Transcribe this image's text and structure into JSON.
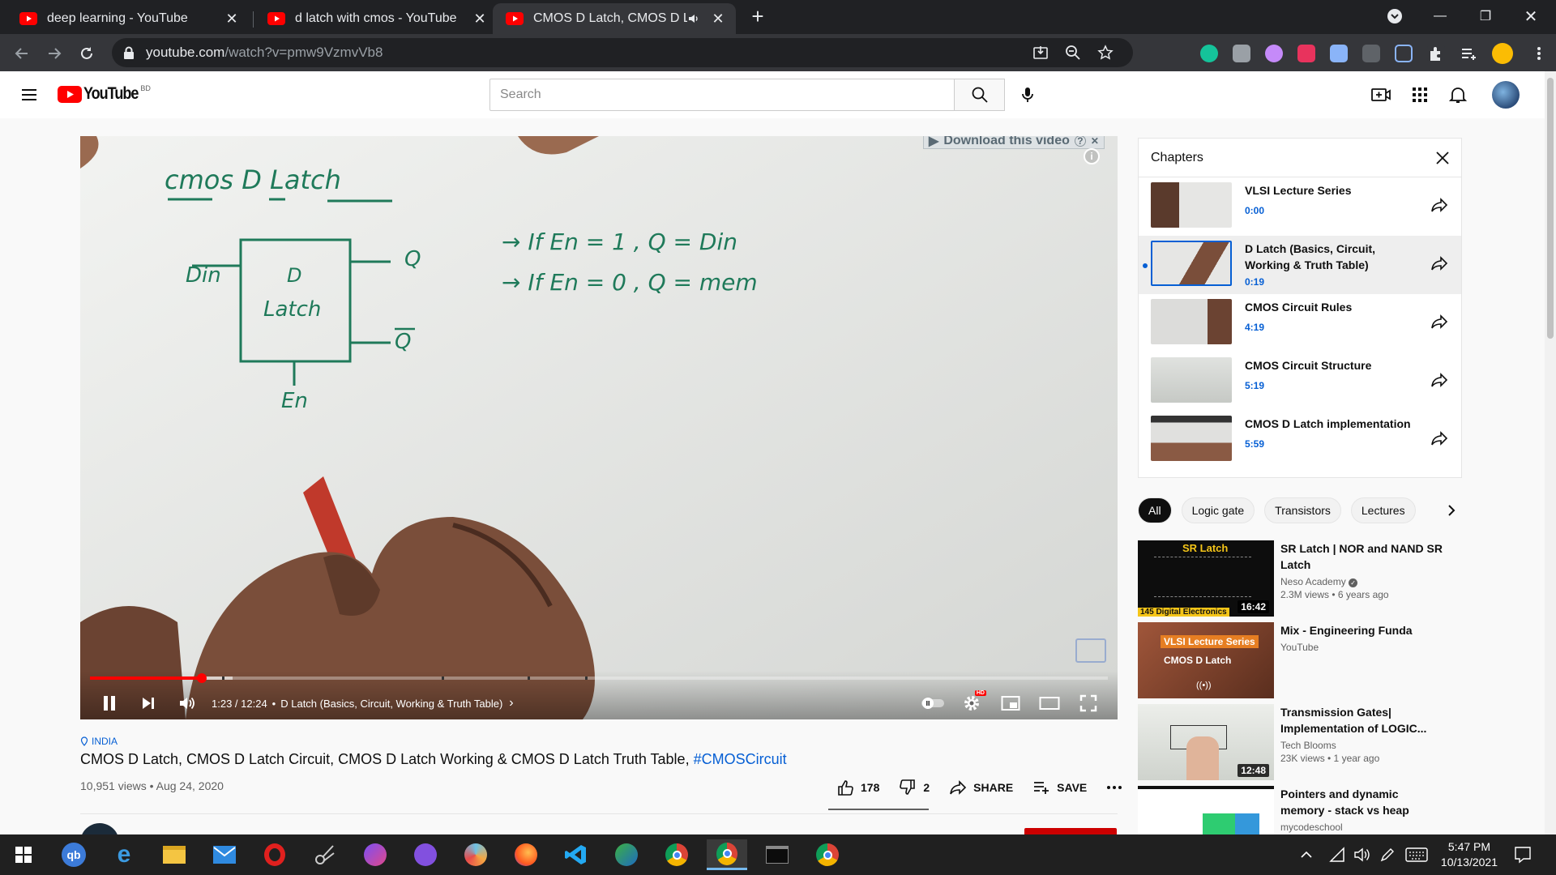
{
  "browser": {
    "tabs": [
      {
        "title": "deep learning - YouTube"
      },
      {
        "title": "d latch with cmos - YouTube"
      },
      {
        "title": "CMOS D Latch, CMOS D Latc"
      }
    ],
    "url_prefix": "youtube.com",
    "url_path": "/watch?v=pmw9VzmvVb8"
  },
  "masthead": {
    "logo_text": "YouTube",
    "country_code": "BD",
    "search_placeholder": "Search"
  },
  "player": {
    "overlay_download": "Download this video",
    "time": "1:23 / 12:24",
    "chapter_label": "D Latch (Basics, Circuit, Working & Truth Table)",
    "progress_fraction": 0.11,
    "buffered_fraction": 0.14,
    "board_title": "cmos D Latch",
    "board_input": "Din",
    "board_block_line1": "D",
    "board_block_line2": "Latch",
    "board_out_q": "Q",
    "board_out_qbar": "Q",
    "board_enable": "En",
    "board_rule1": "→ If En = 1 ,  Q = Din",
    "board_rule2": "→ If En = 0 ,  Q = mem"
  },
  "video": {
    "location": "INDIA",
    "title": "CMOS D Latch, CMOS D Latch Circuit, CMOS D Latch Working & CMOS D Latch Truth Table,",
    "hashtag": "#CMOSCircuit",
    "meta": "10,951 views • Aug 24, 2020",
    "likes": "178",
    "dislikes": "2",
    "share_label": "SHARE",
    "save_label": "SAVE"
  },
  "chapters": {
    "heading": "Chapters",
    "items": [
      {
        "title": "VLSI Lecture Series",
        "time": "0:00"
      },
      {
        "title": "D Latch (Basics, Circuit, Working & Truth Table)",
        "time": "0:19"
      },
      {
        "title": "CMOS Circuit Rules",
        "time": "4:19"
      },
      {
        "title": "CMOS Circuit Structure",
        "time": "5:19"
      },
      {
        "title": "CMOS D Latch implementation",
        "time": "5:59"
      }
    ]
  },
  "chips": [
    "All",
    "Logic gate",
    "Transistors",
    "Lectures"
  ],
  "related": [
    {
      "title": "SR Latch | NOR and NAND SR Latch",
      "channel": "Neso Academy",
      "meta": "2.3M views • 6 years ago",
      "duration": "16:42",
      "thumb_title": "SR Latch",
      "thumb_badge": "145 Digital Electronics"
    },
    {
      "title": "Mix - Engineering Funda",
      "channel": "YouTube",
      "meta": "",
      "duration": "",
      "thumb_title": "VLSI Lecture Series",
      "thumb_badge": "CMOS D Latch"
    },
    {
      "title": "Transmission Gates| Implementation of LOGIC...",
      "channel": "Tech Blooms",
      "meta": "23K views • 1 year ago",
      "duration": "12:48",
      "thumb_title": "",
      "thumb_badge": ""
    },
    {
      "title": "Pointers and dynamic memory - stack vs heap",
      "channel": "mycodeschool",
      "meta": "",
      "duration": "",
      "thumb_title": "",
      "thumb_badge": ""
    }
  ],
  "taskbar": {
    "time": "5:47 PM",
    "date": "10/13/2021"
  },
  "colors": {
    "youtube_red": "#ff0000",
    "link_blue": "#065fd4",
    "chrome_dark": "#202124",
    "ink_green": "#1f7a5a"
  }
}
